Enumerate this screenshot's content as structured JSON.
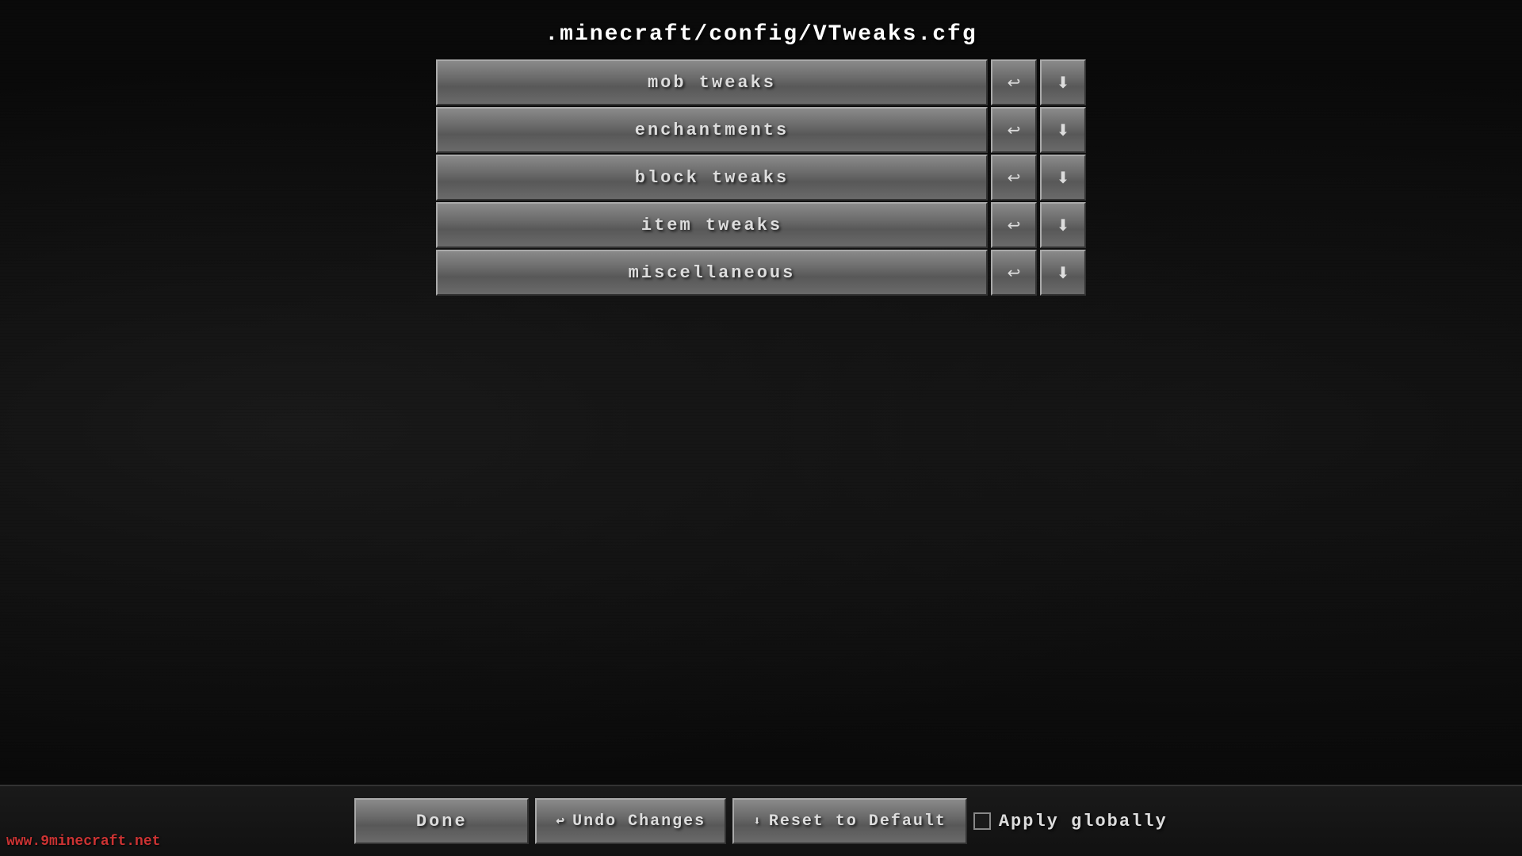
{
  "header": {
    "title": ".minecraft/config/VTweaks.cfg"
  },
  "menu": {
    "items": [
      {
        "id": "mob-tweaks",
        "label": "mob tweaks"
      },
      {
        "id": "enchantments",
        "label": "enchantments"
      },
      {
        "id": "block-tweaks",
        "label": "block tweaks"
      },
      {
        "id": "item-tweaks",
        "label": "item tweaks"
      },
      {
        "id": "miscellaneous",
        "label": "miscellaneous"
      }
    ],
    "undo_icon": "↩",
    "reset_icon": "⬇"
  },
  "bottom_bar": {
    "done_label": "Done",
    "undo_label": "Undo Changes",
    "reset_label": "Reset to Default",
    "apply_label": "Apply globally"
  },
  "watermark": {
    "text": "www.9minecraft.net"
  }
}
